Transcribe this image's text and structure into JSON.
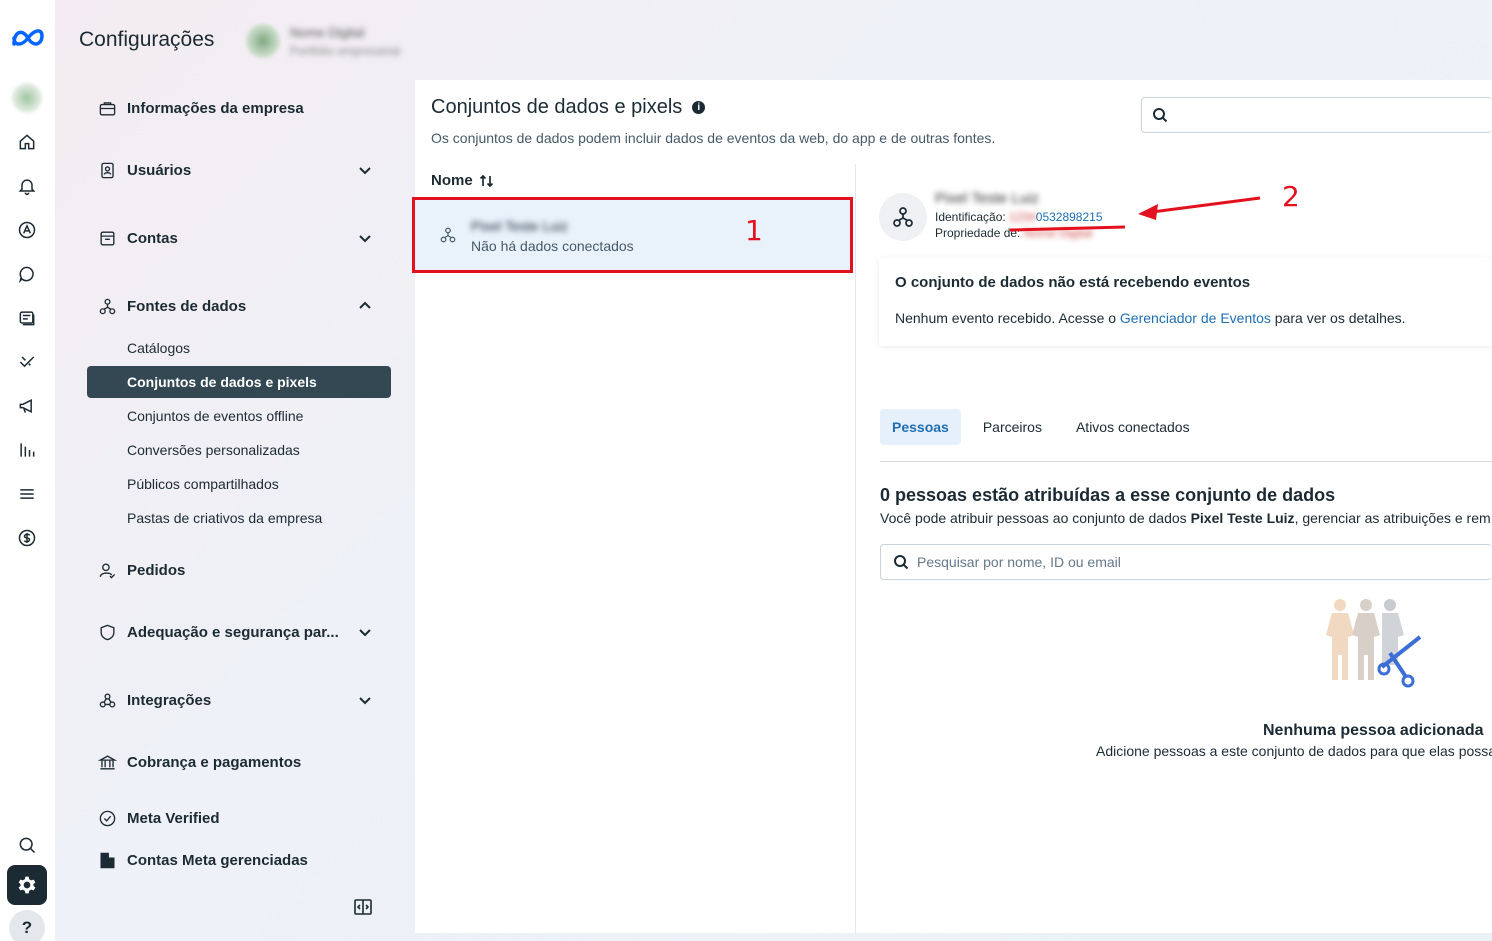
{
  "header": {
    "title": "Configurações",
    "business_name": "Nome Digital",
    "business_sub": "Portfólio empresarial"
  },
  "rail": {
    "icons": [
      "meta-logo-icon",
      "home-icon",
      "bell-icon",
      "advantage-icon",
      "chat-icon",
      "pages-icon",
      "handshake-icon",
      "megaphone-icon",
      "chart-icon",
      "menu-icon",
      "dollar-icon",
      "search-icon",
      "gear-icon",
      "help-icon"
    ]
  },
  "nav": {
    "items": [
      {
        "label": "Informações da empresa",
        "icon": "briefcase-icon"
      },
      {
        "label": "Usuários",
        "icon": "user-card-icon"
      },
      {
        "label": "Contas",
        "icon": "accounts-icon"
      },
      {
        "label": "Fontes de dados",
        "icon": "data-sources-icon"
      },
      {
        "label": "Pedidos",
        "icon": "person-check-icon"
      },
      {
        "label": "Adequação e segurança par...",
        "icon": "shield-icon"
      },
      {
        "label": "Integrações",
        "icon": "integrations-icon"
      },
      {
        "label": "Cobrança e pagamentos",
        "icon": "bank-icon"
      },
      {
        "label": "Meta Verified",
        "icon": "verified-icon"
      },
      {
        "label": "Contas Meta gerenciadas",
        "icon": "building-icon"
      }
    ],
    "sub_items": [
      "Catálogos",
      "Conjuntos de dados e pixels",
      "Conjuntos de eventos offline",
      "Conversões personalizadas",
      "Públicos compartilhados",
      "Pastas de criativos da empresa"
    ]
  },
  "main": {
    "title": "Conjuntos de dados e pixels",
    "info_glyph": "i",
    "subtitle": "Os conjuntos de dados podem incluir dados de eventos da web, do app e de outras fontes.",
    "search_placeholder": "",
    "column_header": "Nome",
    "dataset": {
      "name": "Pixel Teste Luiz",
      "status": "Não há dados conectados"
    },
    "annotations": {
      "one": "1",
      "two": "2"
    }
  },
  "detail": {
    "name": "Pixel Teste Luiz",
    "id_label": "Identificação:",
    "id_hidden": "1234",
    "id_value": "0532898215",
    "owner_label": "Propriedade de:",
    "owner_hidden": "Nome Digital",
    "card_title": "O conjunto de dados não está recebendo eventos",
    "card_text_before": "Nenhum evento recebido. Acesse o",
    "card_link": "Gerenciador de Eventos",
    "card_text_after": "para ver os detalhes.",
    "tabs": [
      "Pessoas",
      "Parceiros",
      "Ativos conectados"
    ],
    "people_title": "0 pessoas estão atribuídas a esse conjunto de dados",
    "people_sub_before": "Você pode atribuir pessoas ao conjunto de dados",
    "people_sub_bold": "Pixel Teste Luiz",
    "people_sub_after": ", gerenciar as atribuições e rem",
    "people_search_placeholder": "Pesquisar por nome, ID ou email",
    "empty_title": "Nenhuma pessoa adicionada",
    "empty_sub": "Adicione pessoas a este conjunto de dados para que elas possa"
  }
}
